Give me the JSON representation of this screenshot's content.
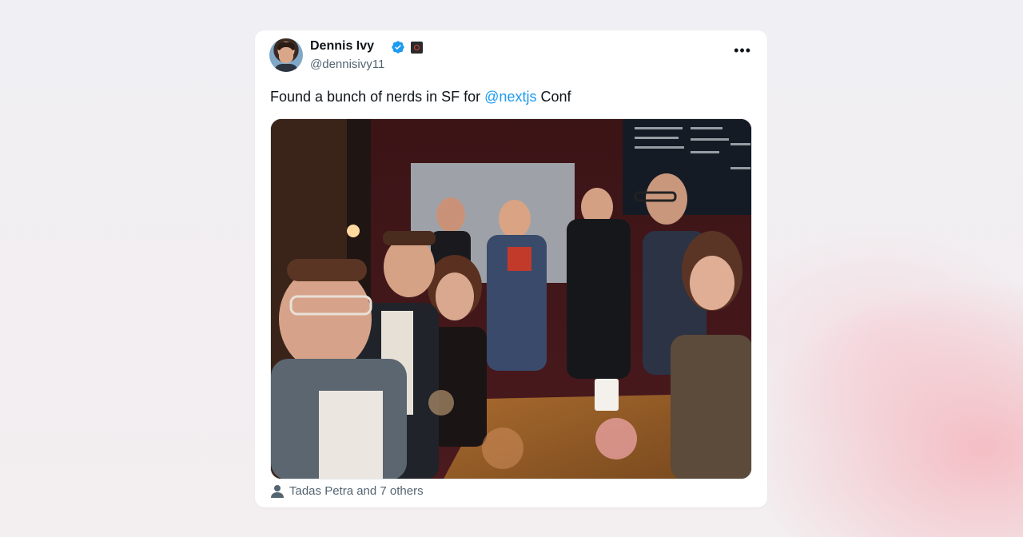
{
  "tweet": {
    "author_name": "Dennis Ivy",
    "author_handle": "@dennisivy11",
    "text_before": "Found a bunch of nerds in SF for ",
    "mention": "@nextjs",
    "text_after": " Conf",
    "tagged": "Tadas Petra and 7 others",
    "icons": [
      "verified-badge-icon",
      "affiliate-badge-icon",
      "more-options-icon",
      "person-tag-icon"
    ],
    "colors": {
      "link": "#1d9bf0",
      "verified": "#1d9bf0",
      "text": "#0f1419",
      "secondary": "#536471"
    }
  }
}
